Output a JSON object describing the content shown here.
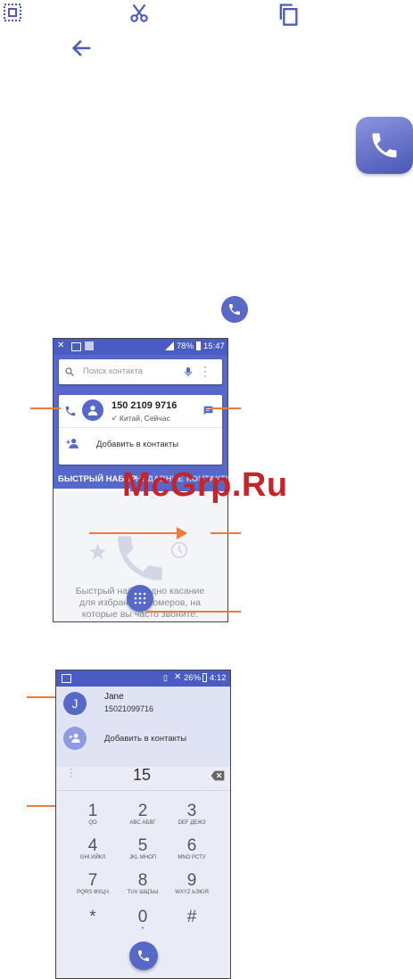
{
  "watermark": "McGrp.Ru",
  "screen1": {
    "status": {
      "battery": "78%",
      "time": "15:47"
    },
    "search": {
      "placeholder": "Поиск контакта"
    },
    "suggestion": {
      "number": "150 2109 9716",
      "detail": "Китай, Сейчас",
      "add_label": "Добавить в контакты"
    },
    "tabs": [
      {
        "label": "БЫСТРЫЙ НАБОР",
        "active": true
      },
      {
        "label": "НЕДАВНИЕ",
        "active": false
      },
      {
        "label": "КОНТАКТЫ",
        "active": false
      }
    ],
    "empty_text": {
      "line1": "Быстрый набор одно касание",
      "line2": "для избранных номеров, на",
      "line3": "которые вы часто звоните."
    }
  },
  "screen2": {
    "status": {
      "battery": "26%",
      "time": "4:12"
    },
    "contact": {
      "initial": "J",
      "name": "Jane",
      "number": "15021099716"
    },
    "add_label": "Добавить в контакты",
    "dial_value": "15",
    "keys": [
      {
        "digit": "1",
        "letters": "QO"
      },
      {
        "digit": "2",
        "letters": "ABC АБВГ"
      },
      {
        "digit": "3",
        "letters": "DEF ДЕЖЗ"
      },
      {
        "digit": "4",
        "letters": "GHI ИЙКЛ"
      },
      {
        "digit": "5",
        "letters": "JKL МНОП"
      },
      {
        "digit": "6",
        "letters": "MNO РСТУ"
      },
      {
        "digit": "7",
        "letters": "PQRS ФХЦЧ"
      },
      {
        "digit": "8",
        "letters": "TUV ШЩЪЫ"
      },
      {
        "digit": "9",
        "letters": "WXYZ ЬЭЮЯ"
      },
      {
        "digit": "*",
        "letters": ""
      },
      {
        "digit": "0",
        "letters": "+"
      },
      {
        "digit": "#",
        "letters": ""
      }
    ]
  },
  "colors": {
    "primary": "#5668c8",
    "accent_orange": "#ee7a3e",
    "watermark": "#c4252b"
  }
}
